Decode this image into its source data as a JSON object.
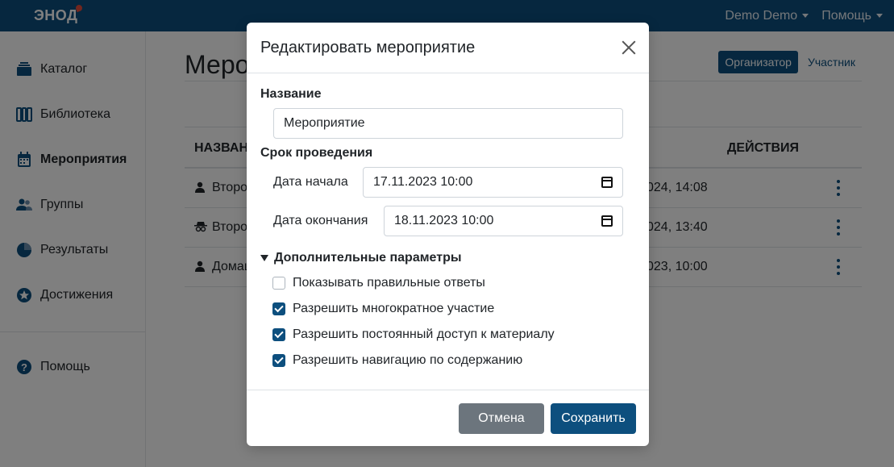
{
  "app": {
    "logo_text": "ЭНОД",
    "user_menu": "Demo Demo",
    "help_menu": "Помощь"
  },
  "sidebar": {
    "items": [
      {
        "label": "Каталог",
        "icon": "catalog-icon",
        "active": false
      },
      {
        "label": "Библиотека",
        "icon": "library-icon",
        "active": false
      },
      {
        "label": "Мероприятия",
        "icon": "calendar-icon",
        "active": true
      },
      {
        "label": "Группы",
        "icon": "group-icon",
        "active": false
      },
      {
        "label": "Результаты",
        "icon": "pie-chart-icon",
        "active": false
      },
      {
        "label": "Достижения",
        "icon": "star-badge-icon",
        "active": false
      }
    ],
    "help": {
      "label": "Помощь",
      "icon": "question-icon"
    }
  },
  "page": {
    "title": "Мероп",
    "roles": {
      "organizer": "Организатор",
      "participant": "Участник"
    },
    "table": {
      "col_name": "НАЗВАН",
      "col_actions": "ДЕЙСТВИЯ",
      "rows": [
        {
          "icon": "user-icon",
          "name": "Второ",
          "date": "024, 14:08"
        },
        {
          "icon": "spy-icon",
          "name": "Второ",
          "date": "024, 13:40"
        },
        {
          "icon": "user-icon",
          "name": "Домаш",
          "date": "023, 10:00"
        }
      ]
    }
  },
  "modal": {
    "title": "Редактировать мероприятие",
    "name_label": "Название",
    "name_value": "Мероприятие",
    "period_label": "Срок проведения",
    "start_label": "Дата начала",
    "start_value": "17.11.2023 10:00",
    "end_label": "Дата окончания",
    "end_value": "18.11.2023 10:00",
    "advanced_label": "Дополнительные параметры",
    "options": [
      {
        "label": "Показывать правильные ответы",
        "checked": false
      },
      {
        "label": "Разрешить многократное участие",
        "checked": true
      },
      {
        "label": "Разрешить постоянный доступ к материалу",
        "checked": true
      },
      {
        "label": "Разрешить навигацию по содержанию",
        "checked": true
      }
    ],
    "cancel_label": "Отмена",
    "save_label": "Сохранить"
  }
}
